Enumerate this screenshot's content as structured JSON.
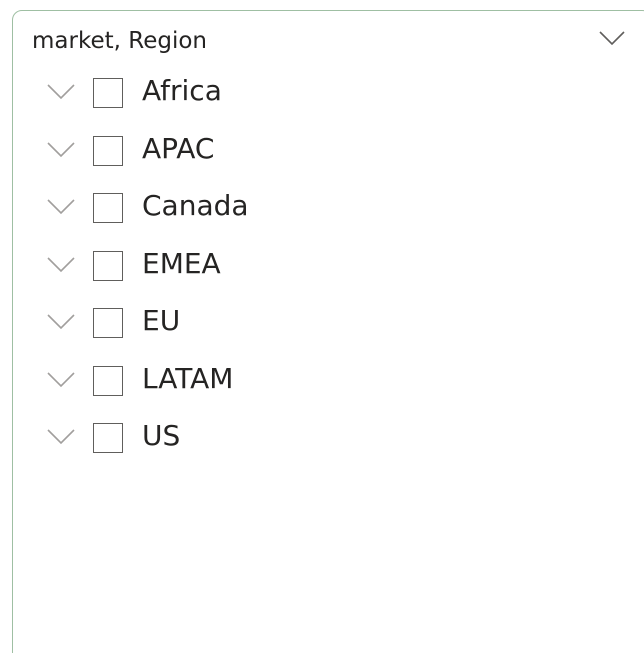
{
  "slicer": {
    "title": "market, Region",
    "header_icon": "chevron-down-icon",
    "items": [
      {
        "label": "Africa",
        "checked": false,
        "expand_icon": "chevron-down-icon"
      },
      {
        "label": "APAC",
        "checked": false,
        "expand_icon": "chevron-down-icon"
      },
      {
        "label": "Canada",
        "checked": false,
        "expand_icon": "chevron-down-icon"
      },
      {
        "label": "EMEA",
        "checked": false,
        "expand_icon": "chevron-down-icon"
      },
      {
        "label": "EU",
        "checked": false,
        "expand_icon": "chevron-down-icon"
      },
      {
        "label": "LATAM",
        "checked": false,
        "expand_icon": "chevron-down-icon"
      },
      {
        "label": "US",
        "checked": false,
        "expand_icon": "chevron-down-icon"
      }
    ]
  },
  "colors": {
    "border": "#9fbfa3",
    "text": "#252423",
    "icon": "#605e5c"
  }
}
